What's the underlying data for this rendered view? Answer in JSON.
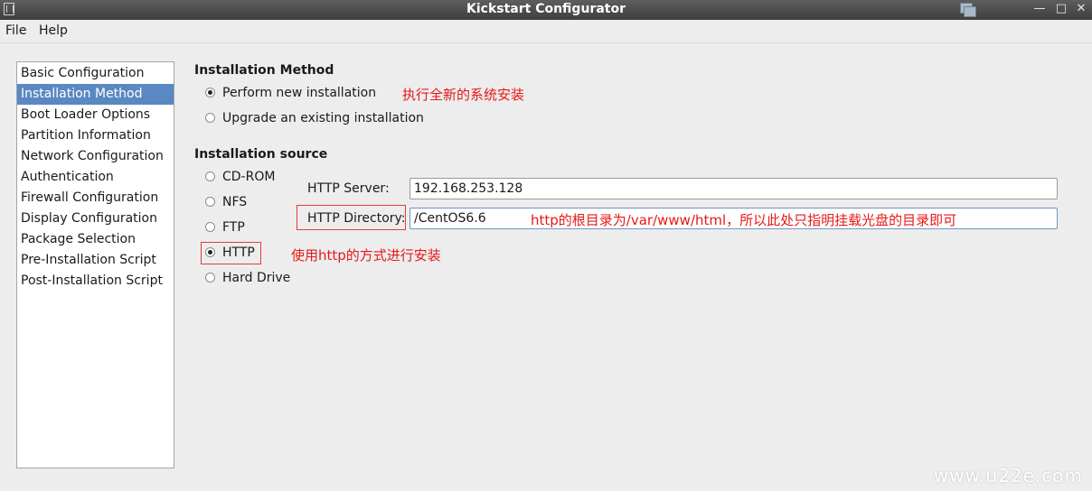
{
  "window": {
    "title": "Kickstart Configurator",
    "buttons": {
      "minimize": "—",
      "maximize": "□",
      "close": "✕"
    }
  },
  "menu": {
    "file": "File",
    "help": "Help"
  },
  "sidebar": {
    "items": [
      {
        "label": "Basic Configuration"
      },
      {
        "label": "Installation Method",
        "selected": true
      },
      {
        "label": "Boot Loader Options"
      },
      {
        "label": "Partition Information"
      },
      {
        "label": "Network Configuration"
      },
      {
        "label": "Authentication"
      },
      {
        "label": "Firewall Configuration"
      },
      {
        "label": "Display Configuration"
      },
      {
        "label": "Package Selection"
      },
      {
        "label": "Pre-Installation Script"
      },
      {
        "label": "Post-Installation Script"
      }
    ]
  },
  "method": {
    "heading": "Installation Method",
    "options": [
      {
        "label": "Perform new installation",
        "checked": true
      },
      {
        "label": "Upgrade an existing installation",
        "checked": false
      }
    ]
  },
  "source": {
    "heading": "Installation source",
    "options": [
      {
        "label": "CD-ROM",
        "checked": false
      },
      {
        "label": "NFS",
        "checked": false
      },
      {
        "label": "FTP",
        "checked": false
      },
      {
        "label": "HTTP",
        "checked": true
      },
      {
        "label": "Hard Drive",
        "checked": false
      }
    ],
    "server_label": "HTTP Server:",
    "server_value": "192.168.253.128",
    "directory_label": "HTTP Directory:",
    "directory_value": "/CentOS6.6"
  },
  "annotations": {
    "new_install": "执行全新的系统安装",
    "http_dir": "http的根目录为/var/www/html，所以此处只指明挂载光盘的目录即可",
    "http_method": "使用http的方式进行安装"
  },
  "watermark": "www.u22e.com",
  "colors": {
    "selection": "#5a88c2",
    "annotation": "#e51919",
    "titlebar": "#4a4a4a"
  }
}
